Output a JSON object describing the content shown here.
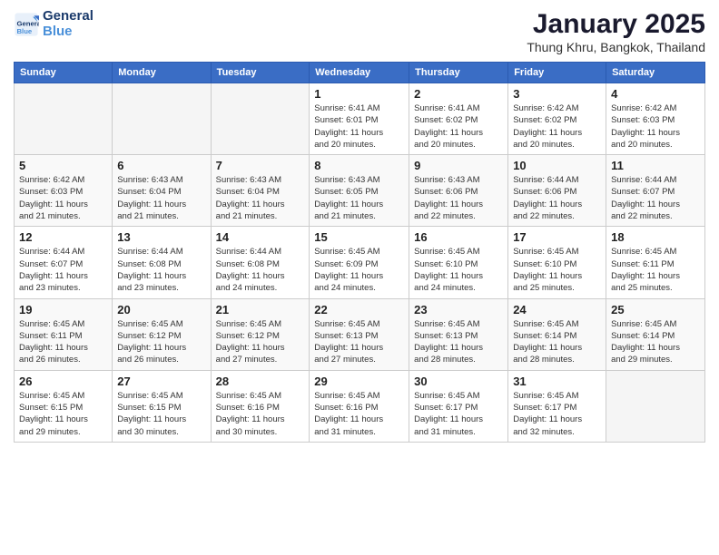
{
  "logo": {
    "line1": "General",
    "line2": "Blue"
  },
  "title": "January 2025",
  "subtitle": "Thung Khru, Bangkok, Thailand",
  "days_of_week": [
    "Sunday",
    "Monday",
    "Tuesday",
    "Wednesday",
    "Thursday",
    "Friday",
    "Saturday"
  ],
  "weeks": [
    [
      {
        "num": "",
        "info": ""
      },
      {
        "num": "",
        "info": ""
      },
      {
        "num": "",
        "info": ""
      },
      {
        "num": "1",
        "info": "Sunrise: 6:41 AM\nSunset: 6:01 PM\nDaylight: 11 hours\nand 20 minutes."
      },
      {
        "num": "2",
        "info": "Sunrise: 6:41 AM\nSunset: 6:02 PM\nDaylight: 11 hours\nand 20 minutes."
      },
      {
        "num": "3",
        "info": "Sunrise: 6:42 AM\nSunset: 6:02 PM\nDaylight: 11 hours\nand 20 minutes."
      },
      {
        "num": "4",
        "info": "Sunrise: 6:42 AM\nSunset: 6:03 PM\nDaylight: 11 hours\nand 20 minutes."
      }
    ],
    [
      {
        "num": "5",
        "info": "Sunrise: 6:42 AM\nSunset: 6:03 PM\nDaylight: 11 hours\nand 21 minutes."
      },
      {
        "num": "6",
        "info": "Sunrise: 6:43 AM\nSunset: 6:04 PM\nDaylight: 11 hours\nand 21 minutes."
      },
      {
        "num": "7",
        "info": "Sunrise: 6:43 AM\nSunset: 6:04 PM\nDaylight: 11 hours\nand 21 minutes."
      },
      {
        "num": "8",
        "info": "Sunrise: 6:43 AM\nSunset: 6:05 PM\nDaylight: 11 hours\nand 21 minutes."
      },
      {
        "num": "9",
        "info": "Sunrise: 6:43 AM\nSunset: 6:06 PM\nDaylight: 11 hours\nand 22 minutes."
      },
      {
        "num": "10",
        "info": "Sunrise: 6:44 AM\nSunset: 6:06 PM\nDaylight: 11 hours\nand 22 minutes."
      },
      {
        "num": "11",
        "info": "Sunrise: 6:44 AM\nSunset: 6:07 PM\nDaylight: 11 hours\nand 22 minutes."
      }
    ],
    [
      {
        "num": "12",
        "info": "Sunrise: 6:44 AM\nSunset: 6:07 PM\nDaylight: 11 hours\nand 23 minutes."
      },
      {
        "num": "13",
        "info": "Sunrise: 6:44 AM\nSunset: 6:08 PM\nDaylight: 11 hours\nand 23 minutes."
      },
      {
        "num": "14",
        "info": "Sunrise: 6:44 AM\nSunset: 6:08 PM\nDaylight: 11 hours\nand 24 minutes."
      },
      {
        "num": "15",
        "info": "Sunrise: 6:45 AM\nSunset: 6:09 PM\nDaylight: 11 hours\nand 24 minutes."
      },
      {
        "num": "16",
        "info": "Sunrise: 6:45 AM\nSunset: 6:10 PM\nDaylight: 11 hours\nand 24 minutes."
      },
      {
        "num": "17",
        "info": "Sunrise: 6:45 AM\nSunset: 6:10 PM\nDaylight: 11 hours\nand 25 minutes."
      },
      {
        "num": "18",
        "info": "Sunrise: 6:45 AM\nSunset: 6:11 PM\nDaylight: 11 hours\nand 25 minutes."
      }
    ],
    [
      {
        "num": "19",
        "info": "Sunrise: 6:45 AM\nSunset: 6:11 PM\nDaylight: 11 hours\nand 26 minutes."
      },
      {
        "num": "20",
        "info": "Sunrise: 6:45 AM\nSunset: 6:12 PM\nDaylight: 11 hours\nand 26 minutes."
      },
      {
        "num": "21",
        "info": "Sunrise: 6:45 AM\nSunset: 6:12 PM\nDaylight: 11 hours\nand 27 minutes."
      },
      {
        "num": "22",
        "info": "Sunrise: 6:45 AM\nSunset: 6:13 PM\nDaylight: 11 hours\nand 27 minutes."
      },
      {
        "num": "23",
        "info": "Sunrise: 6:45 AM\nSunset: 6:13 PM\nDaylight: 11 hours\nand 28 minutes."
      },
      {
        "num": "24",
        "info": "Sunrise: 6:45 AM\nSunset: 6:14 PM\nDaylight: 11 hours\nand 28 minutes."
      },
      {
        "num": "25",
        "info": "Sunrise: 6:45 AM\nSunset: 6:14 PM\nDaylight: 11 hours\nand 29 minutes."
      }
    ],
    [
      {
        "num": "26",
        "info": "Sunrise: 6:45 AM\nSunset: 6:15 PM\nDaylight: 11 hours\nand 29 minutes."
      },
      {
        "num": "27",
        "info": "Sunrise: 6:45 AM\nSunset: 6:15 PM\nDaylight: 11 hours\nand 30 minutes."
      },
      {
        "num": "28",
        "info": "Sunrise: 6:45 AM\nSunset: 6:16 PM\nDaylight: 11 hours\nand 30 minutes."
      },
      {
        "num": "29",
        "info": "Sunrise: 6:45 AM\nSunset: 6:16 PM\nDaylight: 11 hours\nand 31 minutes."
      },
      {
        "num": "30",
        "info": "Sunrise: 6:45 AM\nSunset: 6:17 PM\nDaylight: 11 hours\nand 31 minutes."
      },
      {
        "num": "31",
        "info": "Sunrise: 6:45 AM\nSunset: 6:17 PM\nDaylight: 11 hours\nand 32 minutes."
      },
      {
        "num": "",
        "info": ""
      }
    ]
  ]
}
